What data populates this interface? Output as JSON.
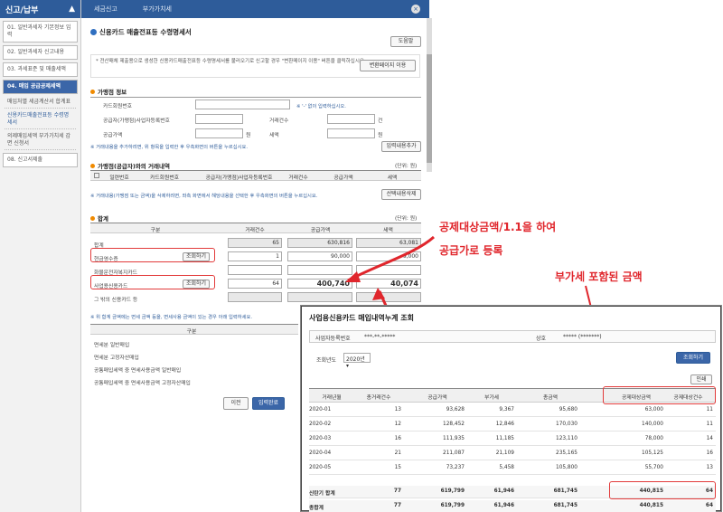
{
  "sidebar": {
    "title": "신고/납부",
    "items": [
      {
        "label": "01. 일반과세자 기본정보 입력",
        "active": false
      },
      {
        "label": "02. 일반과세자 신고내용",
        "active": false
      },
      {
        "label": "03. 과세표준 및 매출세액",
        "active": false
      },
      {
        "label": "04. 매입 공급공제세액",
        "active": true
      }
    ],
    "subs": [
      {
        "label": "매입처별 세금계산서 합계표"
      },
      {
        "label": "신용카드매출전표등 수령명세서"
      },
      {
        "label": "의제매입세액 부가가치세 감면 신청서"
      }
    ],
    "last": "08. 신고서제출"
  },
  "topbar": {
    "tabs": [
      "세금신고",
      "부가가치세"
    ],
    "close_icon": "close-icon"
  },
  "main": {
    "title": "신용카드 매출전표등 수령명세서",
    "help_button": "도움말",
    "notice": "* 전산매체 제출용으로 생성한 신용카드매출전표등 수령명세서를 불러오기로 신고할 경우 \"변환메이지 이용\" 버튼을 클릭하십시요.",
    "convert_button": "변환페이지 이용",
    "merchant_section": "가맹점 정보",
    "card_no_label": "카드회원번호",
    "card_no_note": "※ '-' 없이 입력하십시오.",
    "supplier_label": "공급자(가맹점)사업자등록번호",
    "trx_count_label": "거래건수",
    "count_unit": "건",
    "supply_label": "공급가액",
    "tax_label": "세액",
    "won_unit": "원",
    "merchant_note": "※ 거래내용을 추가하려면, 위 항목을 입력한 후 우측화면의 버튼을 누르십시요.",
    "add_button": "입력내용추가",
    "trx_section": "가맹점(공급자)와의 거래내역",
    "unit_label": "(단위: 원)",
    "trx_headers": [
      "일련번호",
      "카드회원번호",
      "공급자(가맹점)사업자등록번호",
      "거래건수",
      "공급가액",
      "세액"
    ],
    "trx_note": "※ 거래내용(가맹점 또는 금액)을 삭제하려면, 좌측 화면에서 해당내용을 선택한 후 우측화면의 버튼을 누르십시요.",
    "delete_button": "선택내용삭제",
    "total_section": "합계",
    "total_unit": "(단위: 원)",
    "total_headers": [
      "구분",
      "거래건수",
      "공급가액",
      "세액"
    ],
    "rows": [
      {
        "label": "합계",
        "count": "65",
        "supply": "630,816",
        "tax": "63,081",
        "button": ""
      },
      {
        "label": "현금영수증",
        "count": "1",
        "supply": "90,000",
        "tax": "9,000",
        "button": "조회하기"
      },
      {
        "label": "화물운전자복지카드",
        "count": "",
        "supply": "",
        "tax": "",
        "button": ""
      },
      {
        "label": "사업용신용카드",
        "count": "64",
        "supply": "400,740",
        "tax": "40,074",
        "button": "조회하기"
      },
      {
        "label": "그 밖의 신용카드 등",
        "count": "",
        "supply": "",
        "tax": "",
        "button": ""
      }
    ],
    "total_note": "※ 위 합계 금액에는 면세 금액 등을, 면세사용 금액이 있는 경우 아래 입력하세요.",
    "deduct_header": "구분",
    "deduct_rows": [
      "면세분 일반매입",
      "면세분 고정자산매입",
      "공통매입세액 중 면세사용금액 일반매입",
      "공통매입세액 중 면세사용금액 고정자산매입"
    ],
    "prev_button": "이전",
    "next_button": "입력완료"
  },
  "annotations": {
    "a1_line1": "공제대상금액/1.1을 하여",
    "a1_line2": "공급가로 등록",
    "a2": "부가세 포함된 금액"
  },
  "overlay": {
    "title": "사업용신용카드 매입내역누계 조회",
    "reg_label": "사업자등록번호",
    "reg_value": "***-**-*****",
    "name_label": "상호",
    "name_value": "***** (*******)",
    "year_label": "조회년도",
    "year_value": "2020년",
    "search_button": "조회하기",
    "print_button": "인쇄",
    "headers": [
      "거래년월",
      "총거래건수",
      "공급가액",
      "부가세",
      "총금액",
      "공제대상금액",
      "공제대상건수"
    ],
    "rows": [
      [
        "2020-01",
        "13",
        "93,628",
        "9,367",
        "95,680",
        "63,000",
        "11"
      ],
      [
        "2020-02",
        "12",
        "128,452",
        "12,846",
        "170,030",
        "140,000",
        "11"
      ],
      [
        "2020-03",
        "16",
        "111,935",
        "11,185",
        "123,110",
        "78,000",
        "14"
      ],
      [
        "2020-04",
        "21",
        "211,087",
        "21,109",
        "235,165",
        "105,125",
        "16"
      ],
      [
        "2020-05",
        "15",
        "73,237",
        "5,458",
        "105,800",
        "55,700",
        "13"
      ],
      [
        "신탄기 합계",
        "77",
        "619,799",
        "61,946",
        "681,745",
        "440,815",
        "64"
      ],
      [
        "총합계",
        "77",
        "619,799",
        "61,946",
        "681,745",
        "440,815",
        "64"
      ]
    ]
  }
}
